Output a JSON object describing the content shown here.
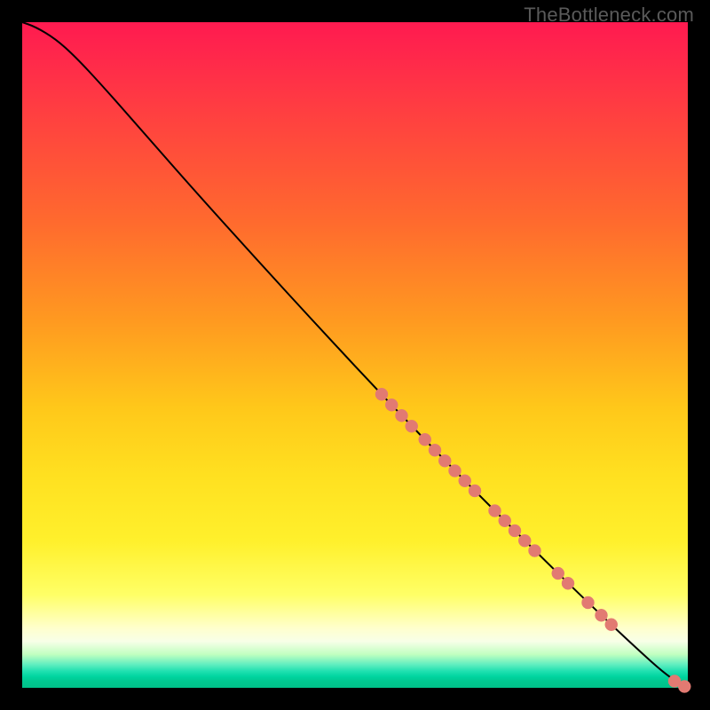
{
  "watermark": "TheBottleneck.com",
  "colors": {
    "marker": "#e27a72",
    "curve": "#000000",
    "markerRadius": 7
  },
  "chart_data": {
    "type": "line",
    "title": "",
    "xlabel": "",
    "ylabel": "",
    "xlim": [
      0,
      100
    ],
    "ylim": [
      0,
      100
    ],
    "grid": false,
    "legend": false,
    "curve": [
      {
        "x": 0,
        "y": 100.0
      },
      {
        "x": 2,
        "y": 99.3
      },
      {
        "x": 5,
        "y": 97.5
      },
      {
        "x": 8,
        "y": 94.8
      },
      {
        "x": 12,
        "y": 90.5
      },
      {
        "x": 18,
        "y": 83.7
      },
      {
        "x": 25,
        "y": 75.7
      },
      {
        "x": 35,
        "y": 64.6
      },
      {
        "x": 45,
        "y": 53.7
      },
      {
        "x": 55,
        "y": 43.0
      },
      {
        "x": 65,
        "y": 32.6
      },
      {
        "x": 75,
        "y": 22.6
      },
      {
        "x": 85,
        "y": 12.8
      },
      {
        "x": 92,
        "y": 6.2
      },
      {
        "x": 97,
        "y": 1.7
      },
      {
        "x": 100,
        "y": 0.0
      }
    ],
    "points": [
      {
        "x": 54.0,
        "y": 44.1
      },
      {
        "x": 55.5,
        "y": 42.5
      },
      {
        "x": 57.0,
        "y": 40.9
      },
      {
        "x": 58.5,
        "y": 39.3
      },
      {
        "x": 60.5,
        "y": 37.3
      },
      {
        "x": 62.0,
        "y": 35.7
      },
      {
        "x": 63.5,
        "y": 34.1
      },
      {
        "x": 65.0,
        "y": 32.6
      },
      {
        "x": 66.5,
        "y": 31.1
      },
      {
        "x": 68.0,
        "y": 29.6
      },
      {
        "x": 71.0,
        "y": 26.6
      },
      {
        "x": 72.5,
        "y": 25.1
      },
      {
        "x": 74.0,
        "y": 23.6
      },
      {
        "x": 75.5,
        "y": 22.1
      },
      {
        "x": 77.0,
        "y": 20.6
      },
      {
        "x": 80.5,
        "y": 17.2
      },
      {
        "x": 82.0,
        "y": 15.7
      },
      {
        "x": 85.0,
        "y": 12.8
      },
      {
        "x": 87.0,
        "y": 10.9
      },
      {
        "x": 88.5,
        "y": 9.5
      },
      {
        "x": 98.0,
        "y": 1.0
      },
      {
        "x": 99.5,
        "y": 0.2
      }
    ]
  }
}
